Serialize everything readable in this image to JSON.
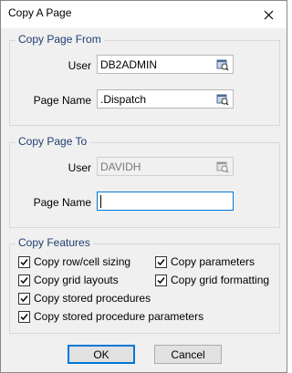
{
  "window": {
    "title": "Copy A Page"
  },
  "copy_from": {
    "legend": "Copy Page From",
    "user_label": "User",
    "user_value": "DB2ADMIN",
    "page_label": "Page Name",
    "page_value": ".Dispatch"
  },
  "copy_to": {
    "legend": "Copy Page To",
    "user_label": "User",
    "user_value": "DAVIDH",
    "page_label": "Page Name",
    "page_value": ""
  },
  "features": {
    "legend": "Copy Features",
    "items": [
      {
        "label": "Copy row/cell sizing",
        "checked": true
      },
      {
        "label": "Copy parameters",
        "checked": true
      },
      {
        "label": "Copy grid layouts",
        "checked": true
      },
      {
        "label": "Copy grid formatting",
        "checked": true
      },
      {
        "label": "Copy stored procedures",
        "checked": true
      },
      {
        "label": "Copy stored procedure parameters",
        "checked": true
      }
    ]
  },
  "buttons": {
    "ok": "OK",
    "cancel": "Cancel"
  },
  "icons": {
    "close": "close-icon",
    "picker": "lookup-picker-icon",
    "check": "checkmark-icon"
  }
}
